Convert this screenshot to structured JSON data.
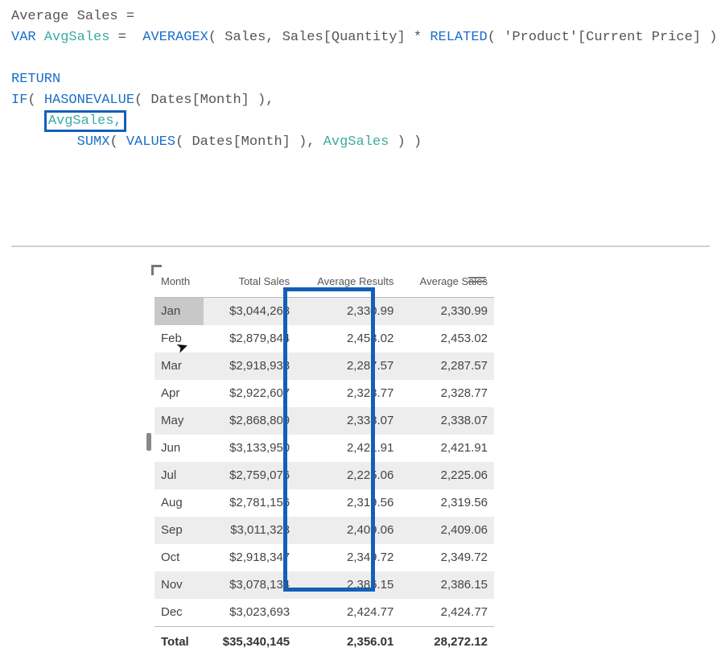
{
  "dax": {
    "line1_a": "Average Sales =",
    "line2_var": "VAR",
    "line2_name": "AvgSales",
    "line2_eq": " =  ",
    "line2_fn": "AVERAGEX",
    "line2_args": "( Sales, Sales[Quantity] * ",
    "line2_rel": "RELATED",
    "line2_tail": "( 'Product'[Current Price] ) )",
    "line4_return": "RETURN",
    "line5_if": "IF",
    "line5_a": "( ",
    "line5_hov": "HASONEVALUE",
    "line5_b": "( Dates[Month] ),",
    "line6_box": "AvgSales,",
    "line7_sumx": "SUMX",
    "line7_a": "( ",
    "line7_values": "VALUES",
    "line7_b": "( Dates[Month] ), ",
    "line7_var": "AvgSales",
    "line7_c": " ) )"
  },
  "table": {
    "headers": [
      "Month",
      "Total Sales",
      "Average Results",
      "Average Sales"
    ],
    "rows": [
      {
        "m": "Jan",
        "t": "$3,044,268",
        "ar": "2,330.99",
        "as": "2,330.99"
      },
      {
        "m": "Feb",
        "t": "$2,879,844",
        "ar": "2,453.02",
        "as": "2,453.02"
      },
      {
        "m": "Mar",
        "t": "$2,918,938",
        "ar": "2,287.57",
        "as": "2,287.57"
      },
      {
        "m": "Apr",
        "t": "$2,922,607",
        "ar": "2,328.77",
        "as": "2,328.77"
      },
      {
        "m": "May",
        "t": "$2,868,809",
        "ar": "2,338.07",
        "as": "2,338.07"
      },
      {
        "m": "Jun",
        "t": "$3,133,950",
        "ar": "2,421.91",
        "as": "2,421.91"
      },
      {
        "m": "Jul",
        "t": "$2,759,076",
        "ar": "2,225.06",
        "as": "2,225.06"
      },
      {
        "m": "Aug",
        "t": "$2,781,156",
        "ar": "2,319.56",
        "as": "2,319.56"
      },
      {
        "m": "Sep",
        "t": "$3,011,323",
        "ar": "2,409.06",
        "as": "2,409.06"
      },
      {
        "m": "Oct",
        "t": "$2,918,347",
        "ar": "2,349.72",
        "as": "2,349.72"
      },
      {
        "m": "Nov",
        "t": "$3,078,134",
        "ar": "2,386.15",
        "as": "2,386.15"
      },
      {
        "m": "Dec",
        "t": "$3,023,693",
        "ar": "2,424.77",
        "as": "2,424.77"
      }
    ],
    "total": {
      "m": "Total",
      "t": "$35,340,145",
      "ar": "2,356.01",
      "as": "28,272.12"
    }
  }
}
